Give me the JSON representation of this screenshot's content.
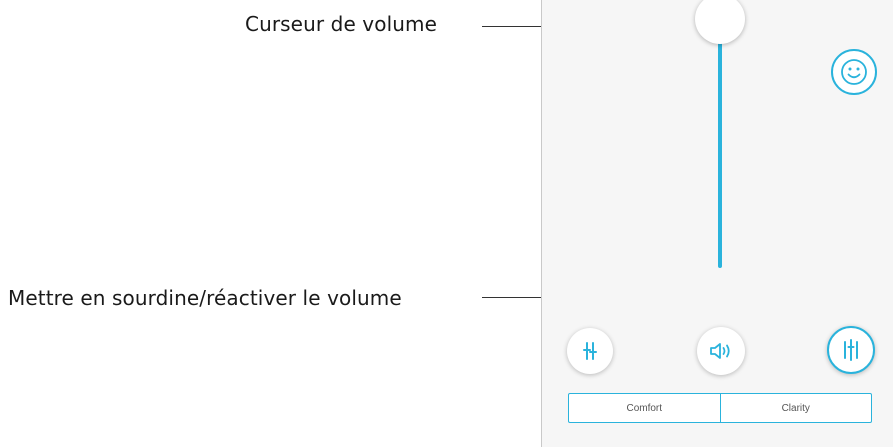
{
  "annotations": {
    "volume_slider": "Curseur de volume",
    "mute_toggle": "Mettre en sourdine/réactiver le volume"
  },
  "volume": {
    "level": 1.0
  },
  "segmented_control": {
    "options": [
      "Comfort",
      "Clarity"
    ]
  },
  "icons": {
    "face": "smiley-icon",
    "left_button": "sliders-icon",
    "center_button": "speaker-icon",
    "right_button": "equalizer-icon"
  },
  "colors": {
    "accent": "#2ab3dc",
    "panel_background": "#f6f6f6"
  }
}
